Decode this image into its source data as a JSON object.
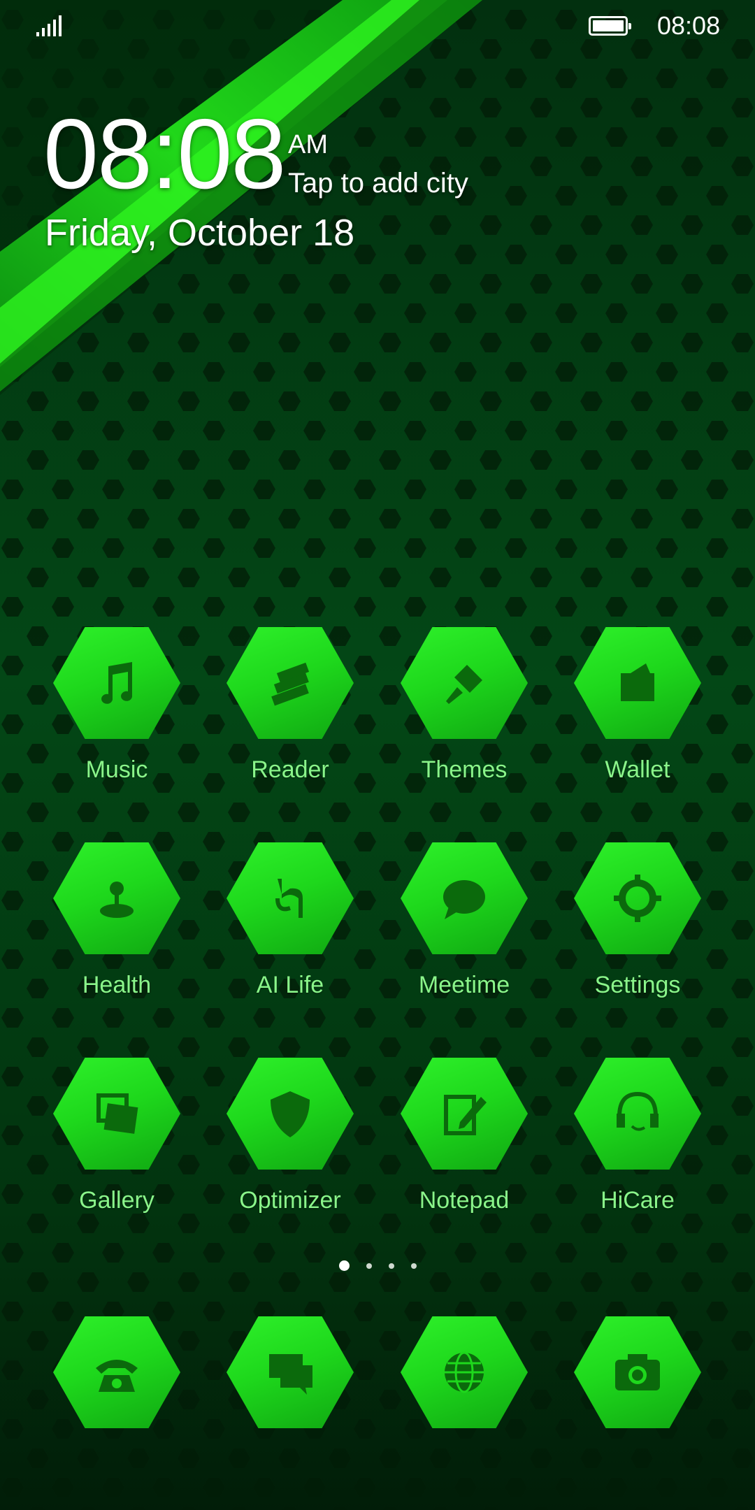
{
  "status_bar": {
    "time": "08:08",
    "signal_icon": "signal-icon",
    "battery_icon": "battery-icon"
  },
  "clock_widget": {
    "hours": "08",
    "separator": ":",
    "minutes": "08",
    "ampm": "AM",
    "city_prompt": "Tap to add city",
    "date": "Friday, October 18"
  },
  "apps": [
    {
      "label": "Music",
      "icon": "music-note-icon"
    },
    {
      "label": "Reader",
      "icon": "books-icon"
    },
    {
      "label": "Themes",
      "icon": "paintbrush-icon"
    },
    {
      "label": "Wallet",
      "icon": "wallet-icon"
    },
    {
      "label": "Health",
      "icon": "health-icon"
    },
    {
      "label": "AI Life",
      "icon": "ai-life-icon"
    },
    {
      "label": "Meetime",
      "icon": "chat-bubble-icon"
    },
    {
      "label": "Settings",
      "icon": "gear-icon"
    },
    {
      "label": "Gallery",
      "icon": "photos-icon"
    },
    {
      "label": "Optimizer",
      "icon": "shield-icon"
    },
    {
      "label": "Notepad",
      "icon": "notepad-icon"
    },
    {
      "label": "HiCare",
      "icon": "headset-icon"
    }
  ],
  "page_indicator": {
    "pages": 4,
    "current": 1
  },
  "dock": [
    {
      "icon": "phone-icon"
    },
    {
      "icon": "messages-icon"
    },
    {
      "icon": "browser-globe-icon"
    },
    {
      "icon": "camera-icon"
    }
  ],
  "colors": {
    "accent": "#22e020",
    "label": "#8af58a",
    "background": "#03420f"
  }
}
